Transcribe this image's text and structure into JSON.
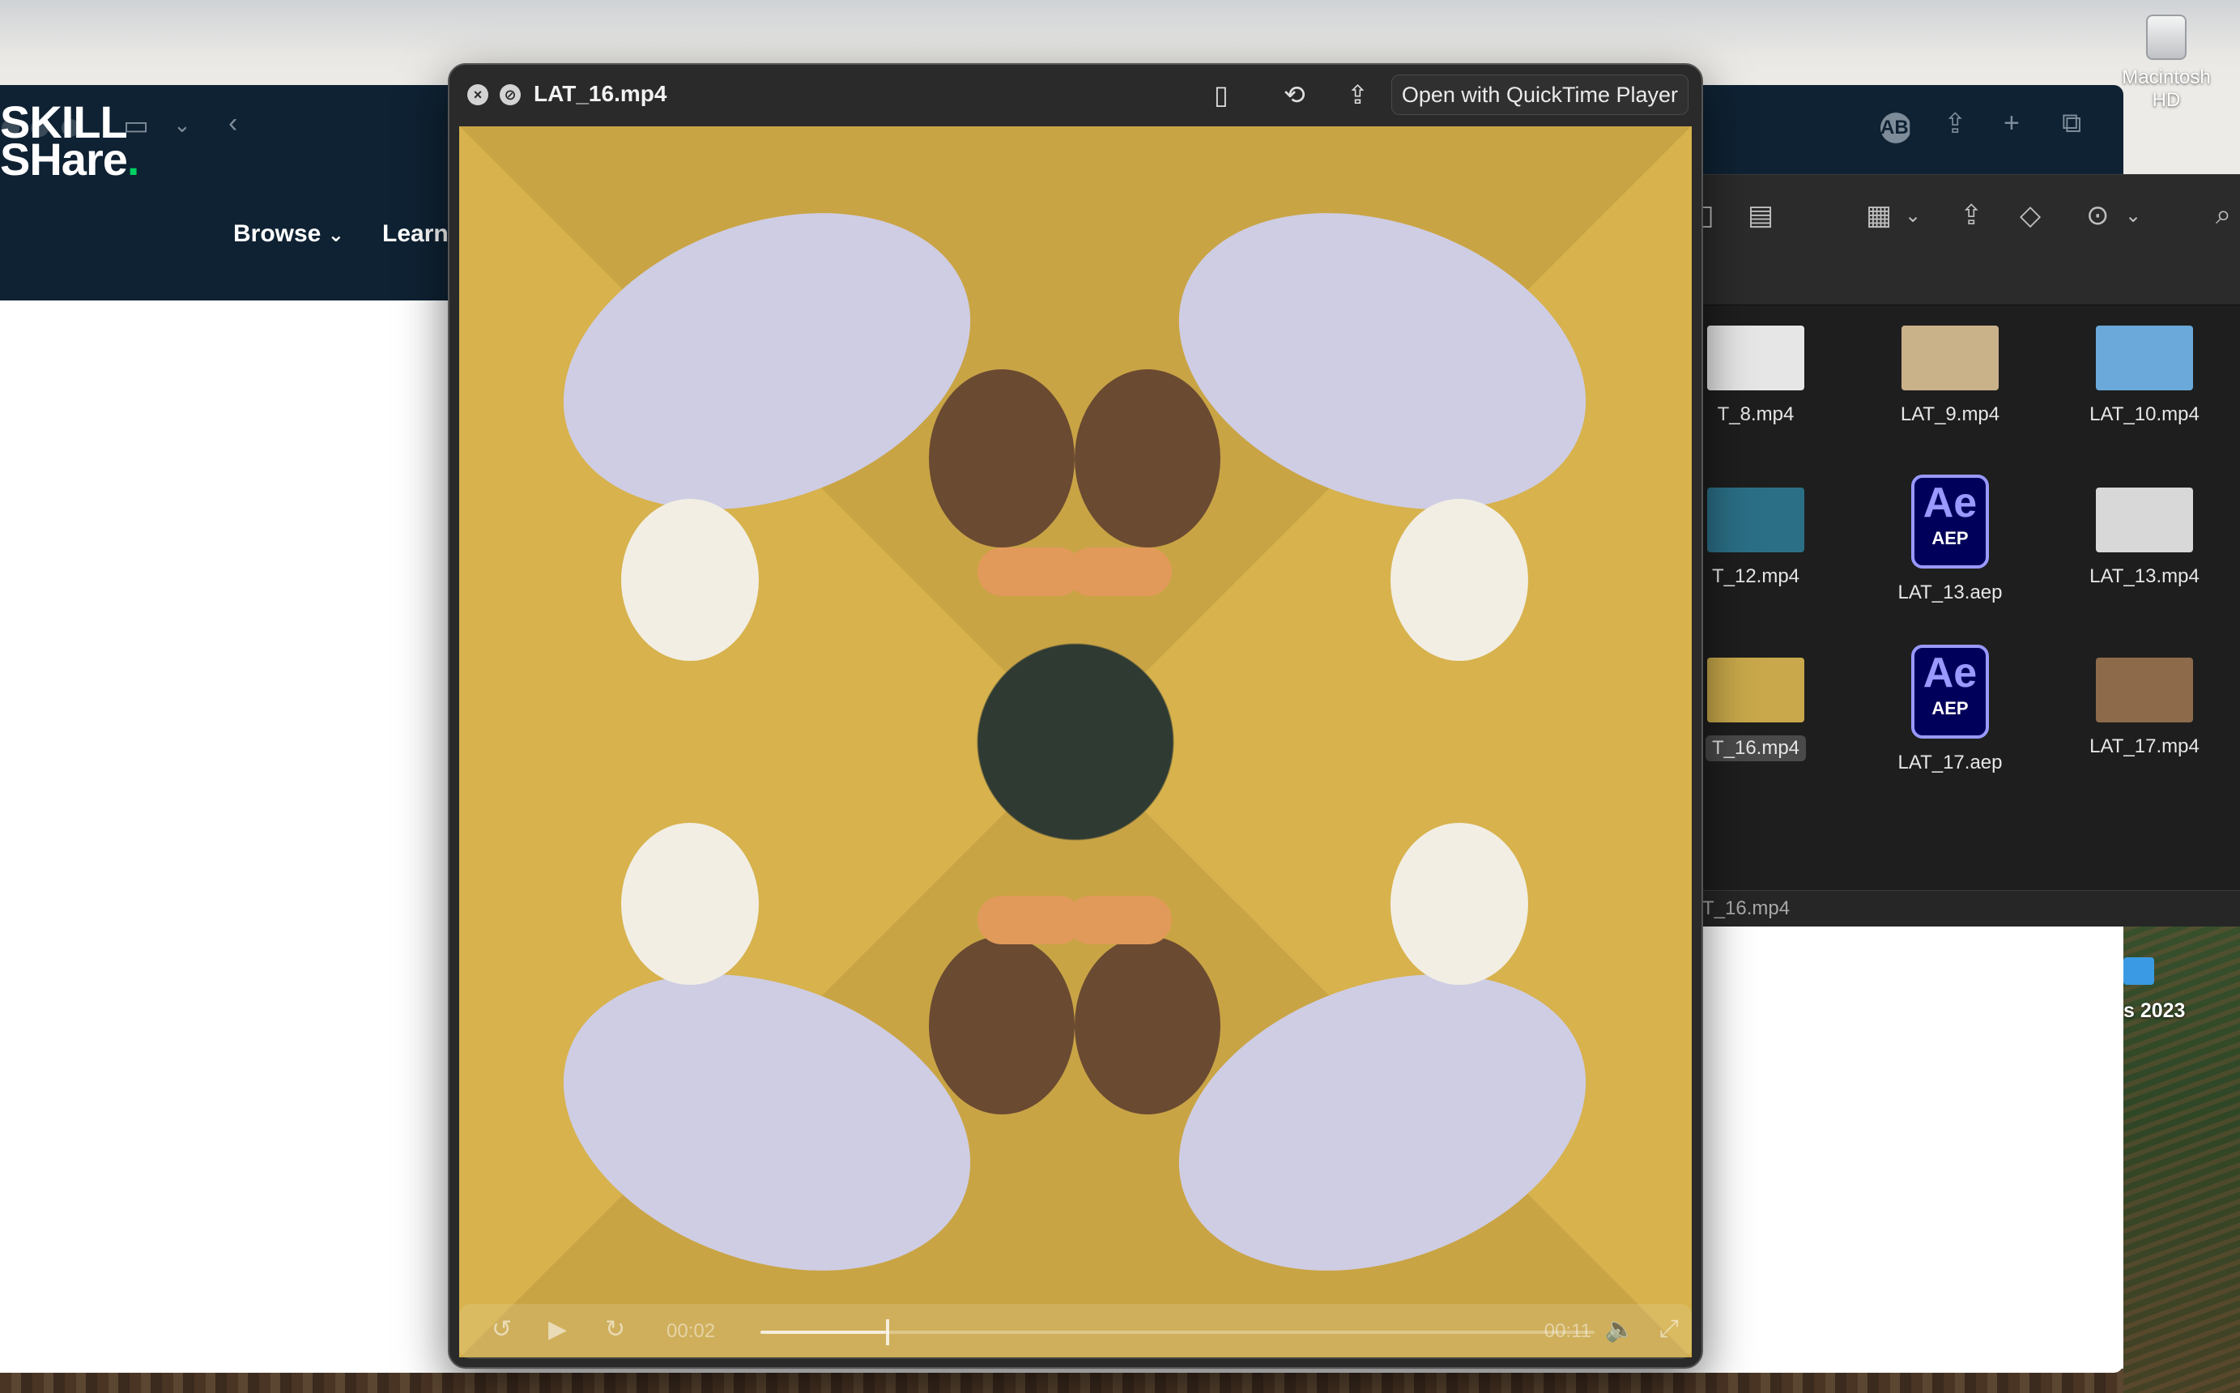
{
  "desktop": {
    "hd_label": "Macintosh HD",
    "folder_label": "s 2023"
  },
  "safari": {
    "nav": [
      {
        "label": "Browse"
      },
      {
        "label": "Learn"
      }
    ]
  },
  "skillshare": {
    "logo_line1": "SKILL",
    "logo_line2": "SHare",
    "logo_dot": "."
  },
  "quicklook": {
    "filename": "LAT_16.mp4",
    "open_with": "Open with QuickTime Player",
    "time_elapsed": "00:02",
    "time_remaining": "00:11",
    "progress": 0.15
  },
  "finder": {
    "items": [
      {
        "label": "T_8.mp4",
        "kind": "video",
        "color": "#e6e6e6"
      },
      {
        "label": "LAT_9.mp4",
        "kind": "video",
        "color": "#c9b18a"
      },
      {
        "label": "LAT_10.mp4",
        "kind": "video",
        "color": "#6aa9d9"
      },
      {
        "label": "T_12.mp4",
        "kind": "video",
        "color": "#2b6f86"
      },
      {
        "label": "LAT_13.aep",
        "kind": "aep"
      },
      {
        "label": "LAT_13.mp4",
        "kind": "video",
        "color": "#d8d8d8"
      },
      {
        "label": "T_16.mp4",
        "kind": "video",
        "color": "#c8a84a",
        "selected": true
      },
      {
        "label": "LAT_17.aep",
        "kind": "aep"
      },
      {
        "label": "LAT_17.mp4",
        "kind": "video",
        "color": "#8c6a4a"
      }
    ],
    "ae_big": "Ae",
    "ae_small": "AEP",
    "path": "T_16.mp4"
  }
}
